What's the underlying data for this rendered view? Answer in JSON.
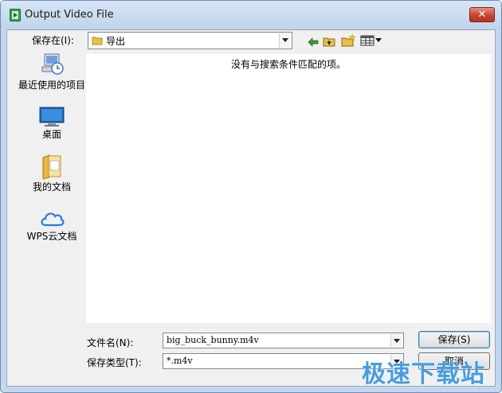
{
  "window": {
    "title": "Output Video File"
  },
  "toolbar": {
    "save_in_label": "保存在(I):",
    "location": "导出"
  },
  "places": [
    {
      "label": "最近使用的项目",
      "icon": "recent-items-icon"
    },
    {
      "label": "桌面",
      "icon": "desktop-icon"
    },
    {
      "label": "我的文档",
      "icon": "documents-folder-icon"
    },
    {
      "label": "WPS云文档",
      "icon": "cloud-icon"
    }
  ],
  "file_list": {
    "empty_message": "没有与搜索条件匹配的项。"
  },
  "form": {
    "filename_label": "文件名(N):",
    "filename_value": "big_buck_bunny.m4v",
    "filetype_label": "保存类型(T):",
    "filetype_value": "*.m4v"
  },
  "buttons": {
    "save": "保存(S)",
    "cancel": "取消"
  },
  "watermark": "极速下载站",
  "colors": {
    "accent": "#3c7fb1",
    "close": "#c7432f",
    "watermark": "#288cdc"
  }
}
